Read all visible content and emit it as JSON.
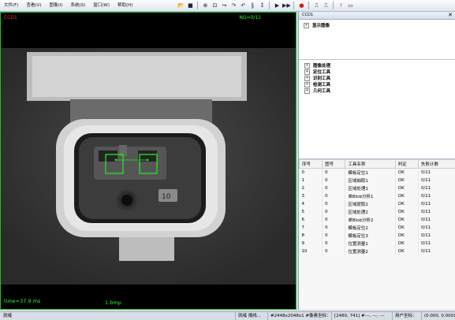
{
  "menu": {
    "items": [
      "文件(F)",
      "查看(V)",
      "图像(I)",
      "系统(S)",
      "窗口(W)",
      "帮助(H)"
    ]
  },
  "toolbar": {
    "icons": [
      "open-folder-icon",
      "save-icon",
      "zoom-in-icon",
      "zoom-fit-icon",
      "step-icon",
      "step-over-icon",
      "step-back-icon",
      "pause-bar-icon",
      "run-icon",
      "run-all-icon",
      "stop-icon",
      "pulse-high-icon",
      "pulse-low-icon",
      "alert-icon",
      "window-icon"
    ]
  },
  "viewer": {
    "camera_label": "CCD1",
    "ng_label": "NG=0/11",
    "time_label": "time=37.9 ms",
    "file_label": "1.bmp",
    "roi_color": "#23e623"
  },
  "panel": {
    "title": "CCD1",
    "tree_top": [
      {
        "label": "显示图像"
      }
    ],
    "tree_tools": [
      {
        "label": "图像处理"
      },
      {
        "label": "定位工具"
      },
      {
        "label": "识别工具"
      },
      {
        "label": "检测工具"
      },
      {
        "label": "几何工具"
      }
    ],
    "table": {
      "headers": [
        "序号",
        "图号",
        "工具名称",
        "判定",
        "失败计数"
      ],
      "rows": [
        [
          "0",
          "0",
          "模板定位1",
          "OK",
          "0/11"
        ],
        [
          "1",
          "0",
          "区域抽取1",
          "OK",
          "0/11"
        ],
        [
          "2",
          "0",
          "区域处理1",
          "OK",
          "0/11"
        ],
        [
          "3",
          "0",
          "单Blob分析1",
          "OK",
          "0/11"
        ],
        [
          "4",
          "0",
          "区域提取2",
          "OK",
          "0/11"
        ],
        [
          "5",
          "0",
          "区域处理2",
          "OK",
          "0/11"
        ],
        [
          "6",
          "0",
          "单Blob分析2",
          "OK",
          "0/11"
        ],
        [
          "7",
          "0",
          "模板定位2",
          "OK",
          "0/11"
        ],
        [
          "8",
          "0",
          "模板定位3",
          "OK",
          "0/11"
        ],
        [
          "9",
          "0",
          "位置测量1",
          "OK",
          "0/11"
        ],
        [
          "10",
          "0",
          "位置测量2",
          "OK",
          "0/11"
        ]
      ]
    }
  },
  "status": {
    "ready": "就绪",
    "ops": "就绪 捐线...",
    "pixel": "#2448x2048x1 #像素坐标：",
    "coord": "[2480, 741] #---, ---, ---",
    "user": "用户坐标：",
    "user_val": "(0.000, 0.000)"
  }
}
